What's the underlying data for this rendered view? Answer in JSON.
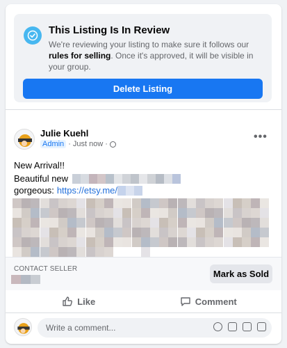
{
  "review": {
    "title": "This Listing Is In Review",
    "text_part1": "We're reviewing your listing to make sure it follows our ",
    "text_bold": "rules for selling",
    "text_part2": ". Once it's approved, it will be visible in your group.",
    "delete_label": "Delete Listing"
  },
  "post": {
    "author": "Julie Kuehl",
    "role": "Admin",
    "time": "Just now",
    "more_label": "•••",
    "line1": "New Arrival!!",
    "line2_prefix": "Beautiful new",
    "line3_prefix": "gorgeous:",
    "link": "https://etsy.me/"
  },
  "contact": {
    "label": "CONTACT SELLER",
    "mark_sold_label": "Mark as Sold"
  },
  "actions": {
    "like_label": "Like",
    "comment_label": "Comment"
  },
  "comment_box": {
    "placeholder": "Write a comment..."
  },
  "colors": {
    "accent": "#1877f2",
    "review_icon": "#47b7f0",
    "link": "#216fdb"
  },
  "icons": [
    "check-circle-icon",
    "globe-icon",
    "more-icon",
    "like-icon",
    "comment-icon",
    "emoji-icon",
    "camera-icon",
    "gif-icon",
    "sticker-icon"
  ]
}
